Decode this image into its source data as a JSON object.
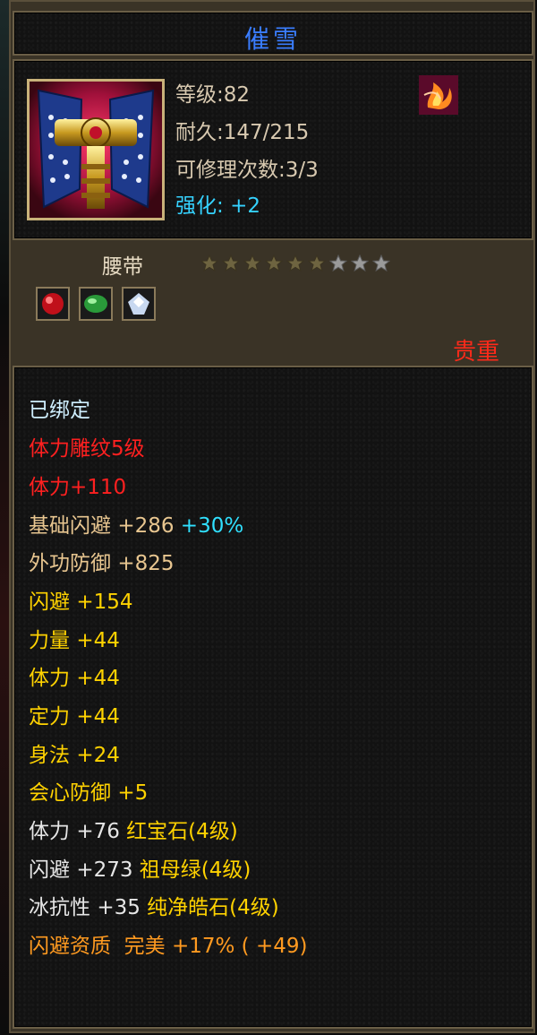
{
  "item": {
    "name": "催雪",
    "level_text": "等级:82",
    "durability_text": "耐久:147/215",
    "repair_text": "可修理次数:3/3",
    "enhance_label": "强化:",
    "enhance_value": "+2",
    "category": "腰带",
    "stars_total": 9,
    "stars_filled": 6,
    "rarity": "贵重"
  },
  "icons": {
    "item_icon": "belt-icon",
    "badge_icon": "flame-badge-icon",
    "gem_slots": [
      "red-gem-icon",
      "green-gem-icon",
      "white-gem-icon"
    ]
  },
  "attributes": {
    "bound": "已绑定",
    "engrave": "体力雕纹5级",
    "engrave_bonus": "体力+110",
    "base_dodge_label": "基础闪避",
    "base_dodge_value": "+286",
    "base_dodge_bonus": "+30%",
    "ext_def_label": "外功防御",
    "ext_def_value": "+825",
    "dodge_label": "闪避",
    "dodge_value": "+154",
    "str_label": "力量",
    "str_value": "+44",
    "vit_label": "体力",
    "vit_value": "+44",
    "spirit_label": "定力",
    "spirit_value": "+44",
    "agi_label": "身法",
    "agi_value": "+24",
    "crit_def_label": "会心防御",
    "crit_def_value": "+5",
    "gem1_stat": "体力",
    "gem1_value": "+76",
    "gem1_name": "红宝石(4级)",
    "gem2_stat": "闪避",
    "gem2_value": "+273",
    "gem2_name": "祖母绿(4级)",
    "gem3_stat": "冰抗性",
    "gem3_value": "+35",
    "gem3_name": "纯净皓石(4级)",
    "quality_label": "闪避资质",
    "quality_grade": "完美",
    "quality_pct": "+17%",
    "quality_extra": "( +49)"
  },
  "colors": {
    "title": "#3a7dff",
    "red": "#ff2020",
    "cyan": "#30e0ff",
    "gold": "#f0c070",
    "orange": "#ff9a20"
  }
}
